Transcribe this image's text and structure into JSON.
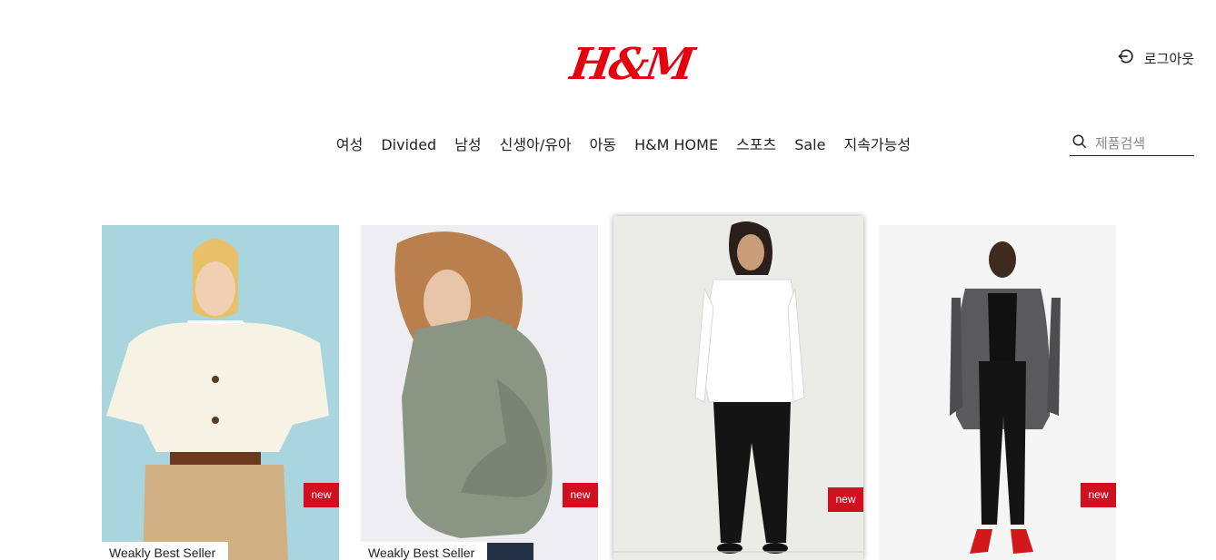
{
  "brand": {
    "logo_text": "H&M",
    "color": "#e50010"
  },
  "header": {
    "logout_label": "로그아웃",
    "logout_icon": "logout-icon"
  },
  "nav": {
    "items": [
      "여성",
      "Divided",
      "남성",
      "신생아/유아",
      "아동",
      "H&M HOME",
      "스포츠",
      "Sale",
      "지속가능성"
    ]
  },
  "search": {
    "placeholder": "제품검색",
    "icon": "search-icon"
  },
  "products": [
    {
      "badge": "new",
      "tag": "Weakly Best Seller"
    },
    {
      "badge": "new",
      "tag": "Weakly Best Seller"
    },
    {
      "badge": "new"
    },
    {
      "badge": "new"
    }
  ],
  "colors": {
    "badge": "#d1101f",
    "accent": "#e50010"
  }
}
